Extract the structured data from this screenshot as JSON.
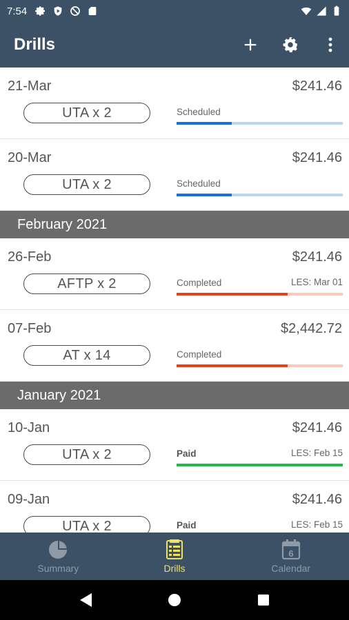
{
  "status_bar": {
    "time": "7:54"
  },
  "app_bar": {
    "title": "Drills"
  },
  "colors": {
    "primary": "#3d5166",
    "scheduled": "#1a6fe0",
    "scheduled_track": "#bcd5f7",
    "completed": "#e8401f",
    "completed_track": "#f7c8bb",
    "paid": "#23b84a",
    "active_nav": "#f0e25c",
    "section_header": "#6b6b6b"
  },
  "list": {
    "items": [
      {
        "kind": "drill",
        "date": "21-Mar",
        "amount": "$241.46",
        "type": "UTA x 2",
        "status": "Scheduled",
        "les": "",
        "progress": 0.33,
        "state": "scheduled"
      },
      {
        "kind": "drill",
        "date": "20-Mar",
        "amount": "$241.46",
        "type": "UTA x 2",
        "status": "Scheduled",
        "les": "",
        "progress": 0.33,
        "state": "scheduled"
      },
      {
        "kind": "header",
        "label": "February 2021"
      },
      {
        "kind": "drill",
        "date": "26-Feb",
        "amount": "$241.46",
        "type": "AFTP x 2",
        "status": "Completed",
        "les": "LES: Mar 01",
        "progress": 0.67,
        "state": "completed"
      },
      {
        "kind": "drill",
        "date": "07-Feb",
        "amount": "$2,442.72",
        "type": "AT x 14",
        "status": "Completed",
        "les": "",
        "progress": 0.67,
        "state": "completed"
      },
      {
        "kind": "header",
        "label": "January 2021"
      },
      {
        "kind": "drill",
        "date": "10-Jan",
        "amount": "$241.46",
        "type": "UTA x 2",
        "status": "Paid",
        "les": "LES: Feb 15",
        "progress": 1.0,
        "state": "paid"
      },
      {
        "kind": "drill",
        "date": "09-Jan",
        "amount": "$241.46",
        "type": "UTA x 2",
        "status": "Paid",
        "les": "LES: Feb 15",
        "progress": 1.0,
        "state": "paid"
      }
    ]
  },
  "bottom_nav": {
    "items": [
      {
        "label": "Summary",
        "icon": "pie-chart-icon",
        "active": false
      },
      {
        "label": "Drills",
        "icon": "drills-list-icon",
        "active": true
      },
      {
        "label": "Calendar",
        "icon": "calendar-icon",
        "active": false,
        "day": "6"
      }
    ]
  }
}
